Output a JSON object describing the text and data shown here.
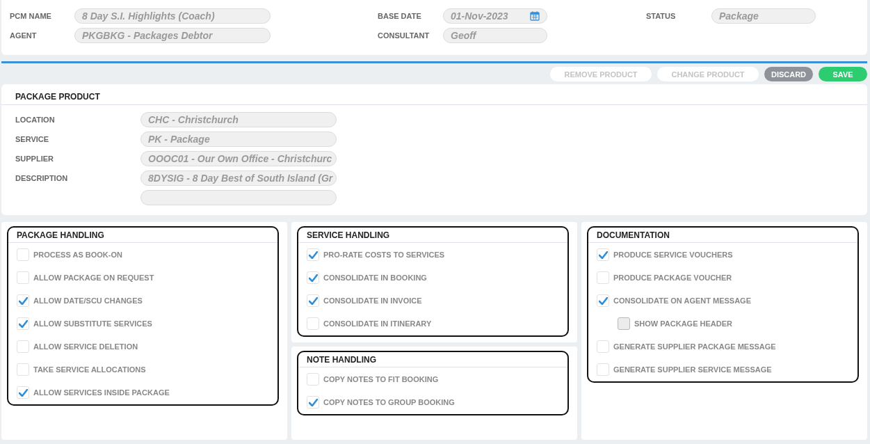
{
  "header": {
    "groups": [
      [
        {
          "label": "PCM NAME",
          "value": "8 Day S.I. Highlights (Coach)",
          "kind": "text"
        },
        {
          "label": "AGENT",
          "value": "PKGBKG - Packages Debtor",
          "kind": "text"
        }
      ],
      [
        {
          "label": "BASE DATE",
          "value": "01-Nov-2023",
          "kind": "date"
        },
        {
          "label": "CONSULTANT",
          "value": "Geoff",
          "kind": "text"
        }
      ],
      [
        {
          "label": "STATUS",
          "value": "Package",
          "kind": "text"
        }
      ]
    ]
  },
  "actions": [
    {
      "label": "REMOVE PRODUCT",
      "kind": "plain",
      "disabled": true
    },
    {
      "label": "CHANGE PRODUCT",
      "kind": "plain",
      "disabled": true
    },
    {
      "label": "DISCARD",
      "kind": "grey",
      "disabled": false
    },
    {
      "label": "SAVE",
      "kind": "green",
      "disabled": false
    }
  ],
  "product": {
    "title": "PACKAGE PRODUCT",
    "fields": [
      {
        "label": "LOCATION",
        "value": "CHC - Christchurch",
        "kind": "text"
      },
      {
        "label": "SERVICE",
        "value": "PK - Package",
        "kind": "text"
      },
      {
        "label": "SUPPLIER",
        "value": "OOOC01 - Our Own Office - Christchurc",
        "kind": "text"
      },
      {
        "label": "DESCRIPTION",
        "value": "8DYSIG - 8 Day Best of South Island (Gr",
        "kind": "text"
      },
      {
        "kind": "blank"
      }
    ]
  },
  "columns": [
    [
      {
        "title": "PACKAGE HANDLING",
        "options": [
          {
            "label": "PROCESS AS BOOK-ON",
            "checked": false,
            "disabled": false
          },
          {
            "label": "ALLOW PACKAGE ON REQUEST",
            "checked": false,
            "disabled": false
          },
          {
            "label": "ALLOW DATE/SCU CHANGES",
            "checked": true,
            "disabled": false
          },
          {
            "label": "ALLOW SUBSTITUTE SERVICES",
            "checked": true,
            "disabled": false
          },
          {
            "label": "ALLOW SERVICE DELETION",
            "checked": false,
            "disabled": false
          },
          {
            "label": "TAKE SERVICE ALLOCATIONS",
            "checked": false,
            "disabled": false
          },
          {
            "label": "ALLOW SERVICES INSIDE PACKAGE",
            "checked": true,
            "disabled": false
          }
        ]
      }
    ],
    [
      {
        "title": "SERVICE HANDLING",
        "options": [
          {
            "label": "PRO-RATE COSTS TO SERVICES",
            "checked": true,
            "disabled": false
          },
          {
            "label": "CONSOLIDATE IN BOOKING",
            "checked": true,
            "disabled": false
          },
          {
            "label": "CONSOLIDATE IN INVOICE",
            "checked": true,
            "disabled": false
          },
          {
            "label": "CONSOLIDATE IN ITINERARY",
            "checked": false,
            "disabled": false
          }
        ]
      },
      {
        "title": "NOTE HANDLING",
        "options": [
          {
            "label": "COPY NOTES TO FIT BOOKING",
            "checked": false,
            "disabled": false
          },
          {
            "label": "COPY NOTES TO GROUP BOOKING",
            "checked": true,
            "disabled": false
          }
        ]
      }
    ],
    [
      {
        "title": "DOCUMENTATION",
        "options": [
          {
            "label": "PRODUCE SERVICE VOUCHERS",
            "checked": true,
            "disabled": false
          },
          {
            "label": "PRODUCE PACKAGE VOUCHER",
            "checked": false,
            "disabled": false
          },
          {
            "label": "CONSOLIDATE ON AGENT MESSAGE",
            "checked": true,
            "disabled": false,
            "children": [
              {
                "label": "SHOW PACKAGE HEADER",
                "checked": false,
                "disabled": true
              }
            ]
          },
          {
            "label": "GENERATE SUPPLIER PACKAGE MESSAGE",
            "checked": false,
            "disabled": false
          },
          {
            "label": "GENERATE SUPPLIER SERVICE MESSAGE",
            "checked": false,
            "disabled": false
          }
        ]
      }
    ]
  ]
}
